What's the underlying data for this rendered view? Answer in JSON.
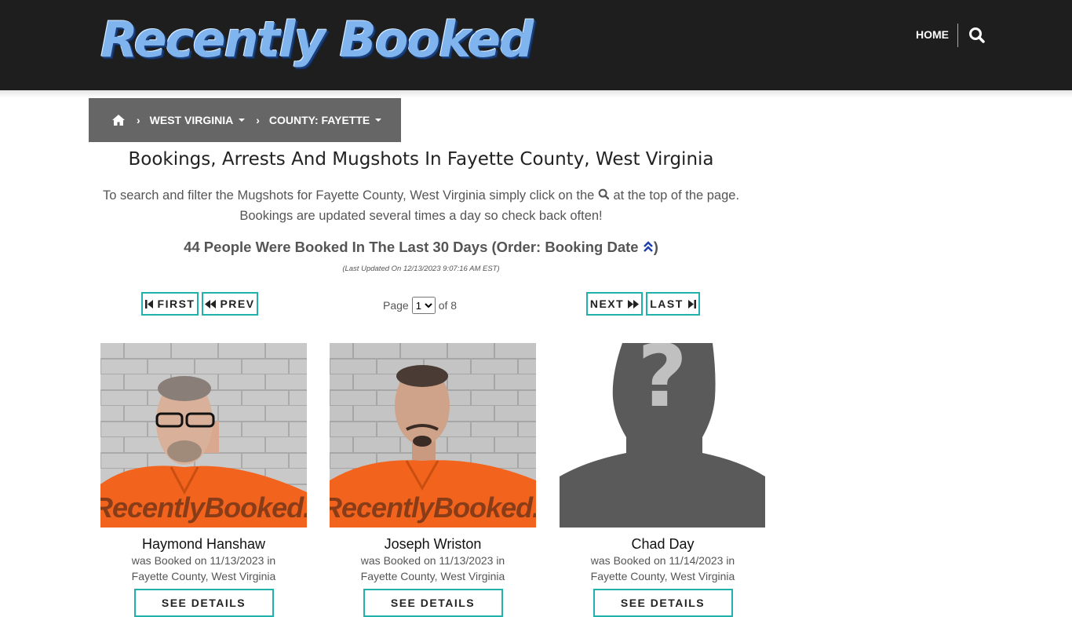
{
  "header": {
    "logo_text": "Recently Booked",
    "nav_home": "HOME",
    "search_icon": "search-icon"
  },
  "breadcrumb": {
    "home_icon": "home-icon",
    "state": "WEST VIRGINIA",
    "county": "COUNTY: FAYETTE"
  },
  "page": {
    "title": "Bookings, Arrests And Mugshots In Fayette County, West Virginia",
    "intro_part1": "To search and filter the Mugshots for Fayette County, West Virginia simply click on the",
    "intro_part2": "at the top of the page.",
    "intro_line2": "Bookings are updated several times a day so check back often!",
    "count_text": "44 People Were Booked In The Last 30 Days (Order: Booking Date",
    "count_close": ")",
    "updated": "(Last Updated On 12/13/2023 9:07:16 AM EST)"
  },
  "pagination": {
    "first": "FIRST",
    "prev": "PREV",
    "next": "NEXT",
    "last": "LAST",
    "page_label": "Page",
    "of_label": "of 8",
    "current_page": "1"
  },
  "watermark": "RecentlyBooked.com",
  "cards": [
    {
      "name": "Haymond Hanshaw",
      "booked_line": "was Booked on 11/13/2023 in",
      "location": "Fayette County, West Virginia",
      "button": "SEE DETAILS"
    },
    {
      "name": "Joseph Wriston",
      "booked_line": "was Booked on 11/13/2023 in",
      "location": "Fayette County, West Virginia",
      "button": "SEE DETAILS"
    },
    {
      "name": "Chad Day",
      "booked_line": "was Booked on 11/14/2023 in",
      "location": "Fayette County, West Virginia",
      "button": "SEE DETAILS"
    }
  ],
  "colors": {
    "header_bg": "#1e1e1e",
    "breadcrumb_bg": "#666666",
    "accent_teal": "#20b2aa",
    "jumpsuit_orange": "#f2641e"
  }
}
